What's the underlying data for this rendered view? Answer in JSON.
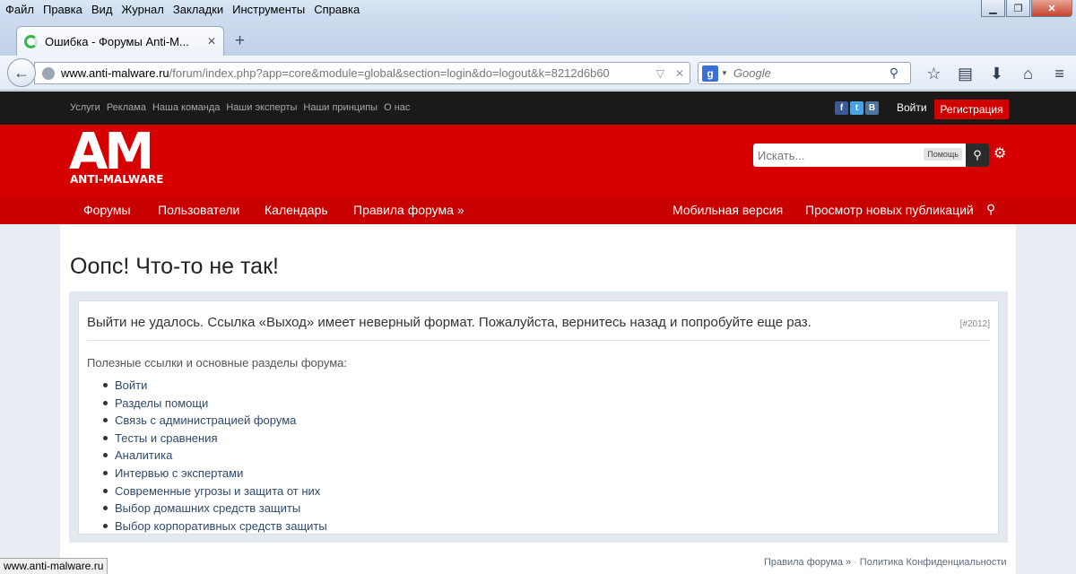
{
  "browser": {
    "menu": [
      "Файл",
      "Правка",
      "Вид",
      "Журнал",
      "Закладки",
      "Инструменты",
      "Справка"
    ],
    "tab_title": "Ошибка - Форумы Anti-M...",
    "url_domain": "www.anti-malware.ru",
    "url_path": "/forum/index.php?app=core&module=global&section=login&do=logout&k=8212d6b60",
    "search_placeholder": "Google",
    "status_url": "www.anti-malware.ru"
  },
  "site": {
    "top_links": [
      "Услуги",
      "Реклама",
      "Наша команда",
      "Наши эксперты",
      "Наши принципы",
      "О нас"
    ],
    "signin": "Войти",
    "register": "Регистрация",
    "logo_main": "AM",
    "logo_sub": "ANTI-MALWARE",
    "search_placeholder": "Искать...",
    "search_help": "Помощь",
    "nav_left": [
      "Форумы",
      "Пользователи",
      "Календарь",
      "Правила форума »"
    ],
    "nav_right": [
      "Мобильная версия",
      "Просмотр новых публикаций"
    ]
  },
  "main": {
    "title": "Оопс! Что-то не так!",
    "error_message": "Выйти не удалось. Ссылка «Выход» имеет неверный формат. Пожалуйста, вернитесь назад и попробуйте еще раз.",
    "error_code": "[#2012]",
    "useful_label": "Полезные ссылки и основные разделы форума:",
    "links": [
      "Войти",
      "Разделы помощи",
      "Связь с администрацией форума",
      "Тесты и сравнения",
      "Аналитика",
      "Интервью с экспертами",
      "Современные угрозы и защита от них",
      "Выбор домашних средств защиты",
      "Выбор корпоративных средств защиты"
    ]
  },
  "footer": {
    "rules": "Правила форума »",
    "separator": "·",
    "privacy": "Политика Конфиденциальности"
  },
  "colors": {
    "brand_red": "#d60000",
    "topbar": "#1a1a1a"
  }
}
